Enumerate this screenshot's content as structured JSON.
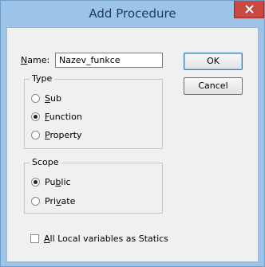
{
  "window": {
    "title": "Add Procedure"
  },
  "name_field": {
    "label_u": "N",
    "label_rest": "ame:",
    "value": "Nazev_funkce"
  },
  "buttons": {
    "ok": "OK",
    "cancel": "Cancel"
  },
  "type_group": {
    "legend": "Type",
    "options": [
      {
        "u": "S",
        "rest": "ub",
        "checked": false
      },
      {
        "u": "F",
        "rest": "unction",
        "checked": true
      },
      {
        "u": "P",
        "rest": "roperty",
        "checked": false
      }
    ]
  },
  "scope_group": {
    "legend": "Scope",
    "options": [
      {
        "pre": "Pu",
        "u": "b",
        "rest": "lic",
        "checked": true
      },
      {
        "pre": "Pri",
        "u": "v",
        "rest": "ate",
        "checked": false
      }
    ]
  },
  "statics_checkbox": {
    "u": "A",
    "rest": "ll Local variables as Statics",
    "checked": false
  }
}
